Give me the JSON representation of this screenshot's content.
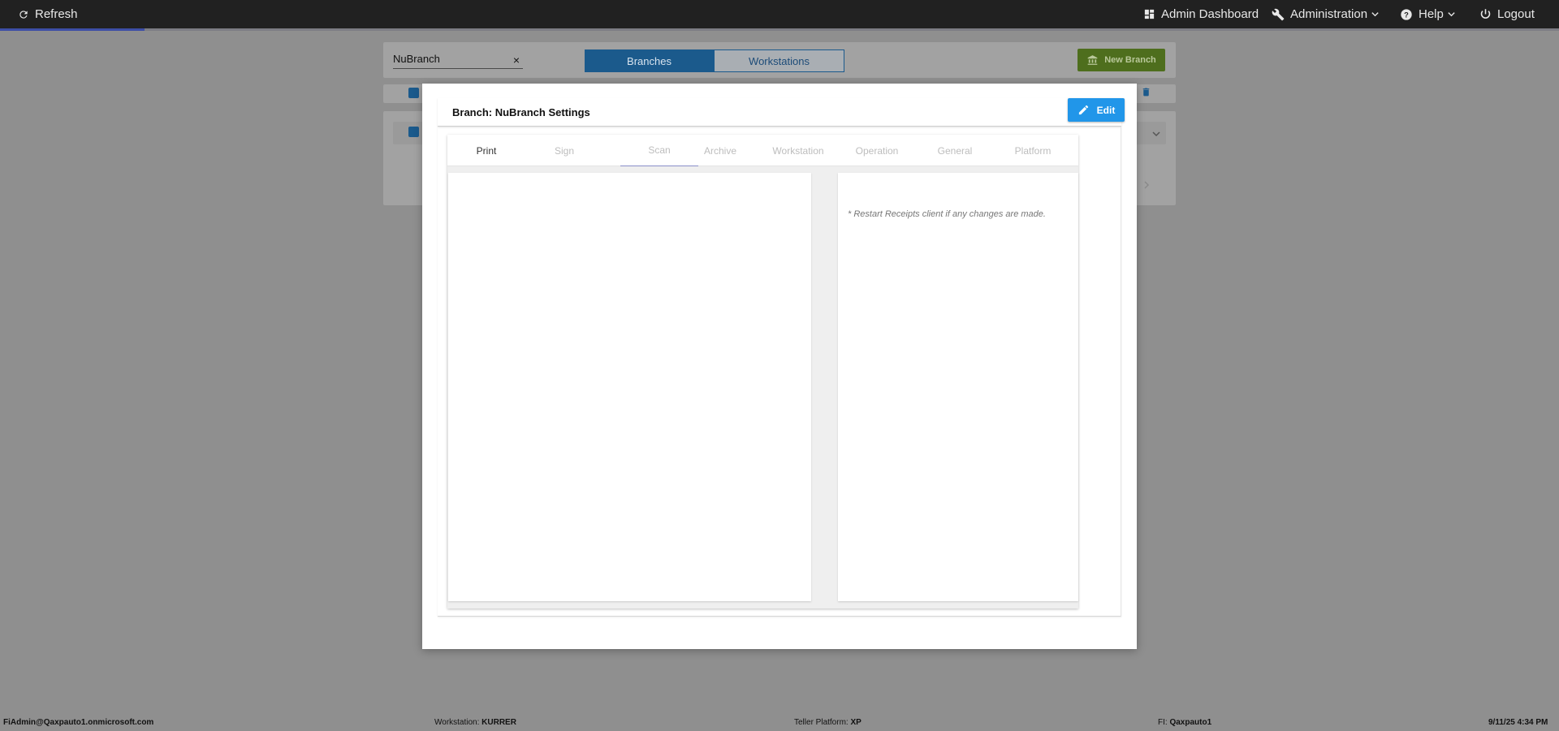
{
  "topbar": {
    "refresh_label": "Refresh",
    "admin_dashboard_label": "Admin Dashboard",
    "administration_label": "Administration",
    "help_label": "Help",
    "logout_label": "Logout"
  },
  "background": {
    "search_value": "NuBranch",
    "clear_icon": "×",
    "tab_branches": "Branches",
    "tab_workstations": "Workstations",
    "new_branch_label": "New Branch"
  },
  "modal": {
    "title": "Branch: NuBranch Settings",
    "edit_label": "Edit",
    "tabs": [
      {
        "label": "Print"
      },
      {
        "label": "Sign"
      },
      {
        "label": "Scan"
      },
      {
        "label": "Archive"
      },
      {
        "label": "Workstation"
      },
      {
        "label": "Operation"
      },
      {
        "label": "General"
      },
      {
        "label": "Platform"
      }
    ],
    "selected_tab": "Scan",
    "note": "* Restart Receipts client if any changes are made."
  },
  "footer": {
    "user": "FiAdmin@Qaxpauto1.onmicrosoft.com",
    "workstation_label": "Workstation:",
    "workstation_value": "KURRER",
    "teller_label": "Teller Platform:",
    "teller_value": "XP",
    "fi_label": "FI:",
    "fi_value": "Qaxpauto1",
    "datetime": "9/11/25 4:34 PM"
  },
  "colors": {
    "topbar": "#212121",
    "accent_blue": "#2196e9",
    "new_branch_green": "#7cb342",
    "overlay": "#8f8f8f"
  },
  "icons": [
    "refresh-icon",
    "dashboard-icon",
    "wrench-icon",
    "help-circle-icon",
    "power-icon",
    "chevron-down-icon",
    "bank-icon",
    "pencil-icon",
    "trash-icon",
    "checkbox-icon"
  ]
}
